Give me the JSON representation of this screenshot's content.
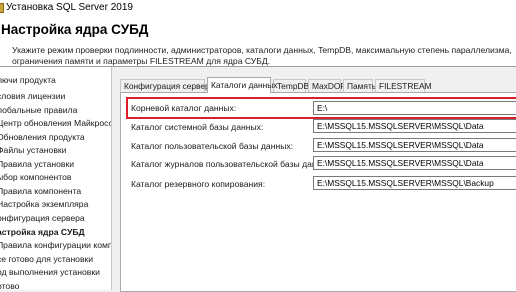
{
  "window": {
    "title": "Установка SQL Server 2019"
  },
  "header": {
    "title": "Настройка ядра СУБД",
    "description": "Укажите режим проверки подлинности, администраторов, каталоги данных, TempDB, максимальную степень параллелизма, ограничения памяти и параметры FILESTREAM для ядра СУБД."
  },
  "sidebar": {
    "items": [
      {
        "label": "лючи продукта"
      },
      {
        "label": "словия лицензии"
      },
      {
        "label": "лобальные правила"
      },
      {
        "label": "Центр обновления Майкросо..."
      },
      {
        "label": "Обновления продукта"
      },
      {
        "label": "Файлы установки"
      },
      {
        "label": "Правила установки"
      },
      {
        "label": "ыбор компонентов"
      },
      {
        "label": "Правила компонента"
      },
      {
        "label": "Настройка экземпляра"
      },
      {
        "label": "онфигурация сервера"
      },
      {
        "label": "астройка ядра СУБД"
      },
      {
        "label": "Правила конфигурации комп..."
      },
      {
        "label": "се готово для установки"
      },
      {
        "label": "од выполнения установки"
      },
      {
        "label": "отово"
      }
    ],
    "active_index": 11
  },
  "tabs": [
    {
      "label": "Конфигурация сервера"
    },
    {
      "label": "Каталоги данных"
    },
    {
      "label": "TempDB"
    },
    {
      "label": "MaxDOP"
    },
    {
      "label": "Память"
    },
    {
      "label": "FILESTREAM"
    }
  ],
  "active_tab": 1,
  "fields": [
    {
      "label": "Корневой каталог данных:",
      "value": "E:\\"
    },
    {
      "label": "Каталог системной базы данных:",
      "value": "E:\\MSSQL15.MSSQLSERVER\\MSSQL\\Data"
    },
    {
      "label": "Каталог пользовательской базы данных:",
      "value": "E:\\MSSQL15.MSSQLSERVER\\MSSQL\\Data"
    },
    {
      "label": "Каталог журналов пользовательской базы данных:",
      "value": "E:\\MSSQL15.MSSQLSERVER\\MSSQL\\Data"
    },
    {
      "label": "Каталог резервного копирования:",
      "value": "E:\\MSSQL15.MSSQLSERVER\\MSSQL\\Backup"
    }
  ],
  "colors": {
    "highlight": "#d9202a",
    "window_bg": "#f0f0f0"
  },
  "icons": {
    "app": "sql-server-setup-icon"
  }
}
